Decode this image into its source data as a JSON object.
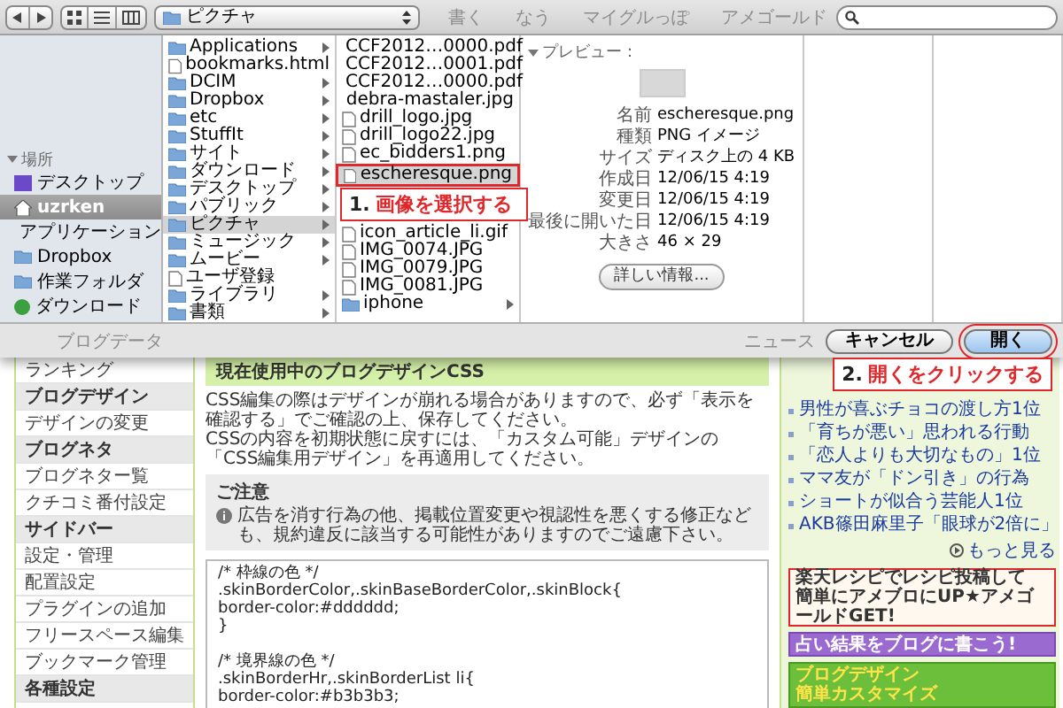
{
  "dialog": {
    "toolbar": {
      "path_popup": "ピクチャ",
      "background_texts": [
        "書く",
        "なう",
        "マイグルっぽ",
        "アメゴールド"
      ]
    },
    "sidebar": {
      "header": "場所",
      "expanded": true,
      "items": [
        {
          "label": "デスクトップ",
          "kind": "desktop",
          "selected": false
        },
        {
          "label": "uzrken",
          "kind": "home",
          "selected": true
        },
        {
          "label": "アプリケーション",
          "kind": "apps",
          "selected": false
        },
        {
          "label": "Dropbox",
          "kind": "folder",
          "selected": false
        },
        {
          "label": "作業フォルダ",
          "kind": "folder",
          "selected": false
        },
        {
          "label": "ダウンロード",
          "kind": "download",
          "selected": false
        }
      ]
    },
    "columns": [
      {
        "items": [
          {
            "name": "Applications",
            "kind": "folder",
            "selected": false,
            "highlighted": false
          },
          {
            "name": "bookmarks.html",
            "kind": "file",
            "selected": false,
            "highlighted": false
          },
          {
            "name": "DCIM",
            "kind": "folder",
            "selected": false,
            "highlighted": false
          },
          {
            "name": "Dropbox",
            "kind": "folder",
            "selected": false,
            "highlighted": false
          },
          {
            "name": "etc",
            "kind": "folder",
            "selected": false,
            "highlighted": false
          },
          {
            "name": "StuffIt",
            "kind": "folder",
            "selected": false,
            "highlighted": false
          },
          {
            "name": "サイト",
            "kind": "folder",
            "selected": false,
            "highlighted": false
          },
          {
            "name": "ダウンロード",
            "kind": "folder",
            "selected": false,
            "highlighted": false
          },
          {
            "name": "デスクトップ",
            "kind": "folder",
            "selected": false,
            "highlighted": false
          },
          {
            "name": "パブリック",
            "kind": "folder",
            "selected": false,
            "highlighted": false
          },
          {
            "name": "ピクチャ",
            "kind": "folder",
            "selected": true,
            "highlighted": false
          },
          {
            "name": "ミュージック",
            "kind": "folder",
            "selected": false,
            "highlighted": false
          },
          {
            "name": "ムービー",
            "kind": "folder",
            "selected": false,
            "highlighted": false
          },
          {
            "name": "ユーザ登録",
            "kind": "file",
            "selected": false,
            "highlighted": false
          },
          {
            "name": "ライブラリ",
            "kind": "folder",
            "selected": false,
            "highlighted": false
          },
          {
            "name": "書類",
            "kind": "folder",
            "selected": false,
            "highlighted": false
          }
        ]
      },
      {
        "items": [
          {
            "name": "CCF2012…0000.pdf",
            "kind": "file",
            "selected": false,
            "highlighted": false
          },
          {
            "name": "CCF2012…0001.pdf",
            "kind": "file",
            "selected": false,
            "highlighted": false
          },
          {
            "name": "CCF2012…0000.pdf",
            "kind": "file",
            "selected": false,
            "highlighted": false
          },
          {
            "name": "debra-mastaler.jpg",
            "kind": "file",
            "selected": false,
            "highlighted": false
          },
          {
            "name": "drill_logo.jpg",
            "kind": "file",
            "selected": false,
            "highlighted": false
          },
          {
            "name": "drill_logo22.jpg",
            "kind": "file",
            "selected": false,
            "highlighted": false
          },
          {
            "name": "ec_bidders1.png",
            "kind": "file",
            "selected": false,
            "highlighted": false
          },
          {
            "name": "escheresque.png",
            "kind": "file",
            "selected": true,
            "highlighted": true
          },
          {
            "name": "icon_article_li.gif",
            "kind": "file",
            "selected": false,
            "highlighted": false
          },
          {
            "name": "IMG_0074.JPG",
            "kind": "file",
            "selected": false,
            "highlighted": false
          },
          {
            "name": "IMG_0079.JPG",
            "kind": "file",
            "selected": false,
            "highlighted": false
          },
          {
            "name": "IMG_0081.JPG",
            "kind": "file",
            "selected": false,
            "highlighted": false
          },
          {
            "name": "iphone",
            "kind": "folder",
            "selected": false,
            "highlighted": false
          }
        ]
      }
    ],
    "preview": {
      "header": "プレビュー：",
      "expanded": true,
      "info": [
        {
          "label": "名前",
          "value": "escheresque.png"
        },
        {
          "label": "種類",
          "value": "PNG イメージ"
        },
        {
          "label": "サイズ",
          "value": "ディスク上の 4 KB"
        },
        {
          "label": "作成日",
          "value": "12/06/15 4:19"
        },
        {
          "label": "変更日",
          "value": "12/06/15 4:19"
        },
        {
          "label": "最後に開いた日",
          "value": "12/06/15 4:19"
        },
        {
          "label": "大きさ",
          "value": "46 × 29"
        }
      ],
      "more_button": "詳しい情報..."
    },
    "bottom_background_texts": [
      "ブログデータ",
      "ニュース"
    ],
    "buttons": [
      {
        "label": "キャンセル",
        "default": false,
        "highlighted": false
      },
      {
        "label": "開く",
        "default": true,
        "highlighted": true
      }
    ]
  },
  "annotations": [
    {
      "kind": "file-step",
      "number": "1.",
      "text": "画像を選択する"
    },
    {
      "kind": "button-step",
      "number": "2.",
      "text": "開くをクリックする"
    }
  ],
  "page": {
    "sidebar": [
      {
        "label": "ランキング",
        "kind": "link"
      },
      {
        "label": "ブログデザイン",
        "kind": "header"
      },
      {
        "label": "デザインの変更",
        "kind": "link"
      },
      {
        "label": "ブログネタ",
        "kind": "header"
      },
      {
        "label": "ブログネター覧",
        "kind": "link"
      },
      {
        "label": "クチコミ番付設定",
        "kind": "link"
      },
      {
        "label": "サイドバー",
        "kind": "header"
      },
      {
        "label": "設定・管理",
        "kind": "link"
      },
      {
        "label": "配置設定",
        "kind": "link"
      },
      {
        "label": "プラグインの追加",
        "kind": "link"
      },
      {
        "label": "フリースペース編集",
        "kind": "link"
      },
      {
        "label": "ブックマーク管理",
        "kind": "link"
      },
      {
        "label": "各種設定",
        "kind": "header"
      }
    ],
    "main": {
      "heading": "現在使用中のブログデザインCSS",
      "paragraphs": [
        "CSS編集の際はデザインが崩れる場合がありますので、必ず「表示を確認する」でご確認の上、保存してください。",
        "CSSの内容を初期状態に戻すには、「カスタム可能」デザインの「CSS編集用デザイン」を再適用してください。"
      ],
      "notice": {
        "title": "ご注意",
        "text": "広告を消す行為の他、掲載位置変更や視認性を悪くする修正なども、規約違反に該当する可能性がありますのでご遠慮下さい。"
      },
      "code_blocks": [
        [
          "/* 枠線の色 */",
          ".skinBorderColor,.skinBaseBorderColor,.skinBlock{",
          "border-color:#dddddd;",
          "}"
        ],
        [
          "/* 境界線の色 */",
          ".skinBorderHr,.skinBorderList li{",
          "border-color:#b3b3b3;"
        ]
      ]
    },
    "news": {
      "items": [
        "男性が喜ぶチョコの渡し方1位",
        "「育ちが悪い」思われる行動",
        "「恋人よりも大切なもの」1位",
        "ママ友が「ドン引き」の行為",
        "ショートが似合う芸能人1位",
        "AKB篠田麻里子「眼球が2倍に」"
      ],
      "more": "もっと見る",
      "banners": [
        {
          "kind": "recipe",
          "lines": [
            "楽天レシピでレシピ投稿して",
            "簡単にアメブロにUP★アメゴールドGET!"
          ]
        },
        {
          "kind": "fortune",
          "lines": [
            "占い結果をブログに書こう!"
          ]
        },
        {
          "kind": "design",
          "lines": [
            "ブログデザイン",
            "簡単カスタマイズ"
          ]
        }
      ]
    }
  }
}
